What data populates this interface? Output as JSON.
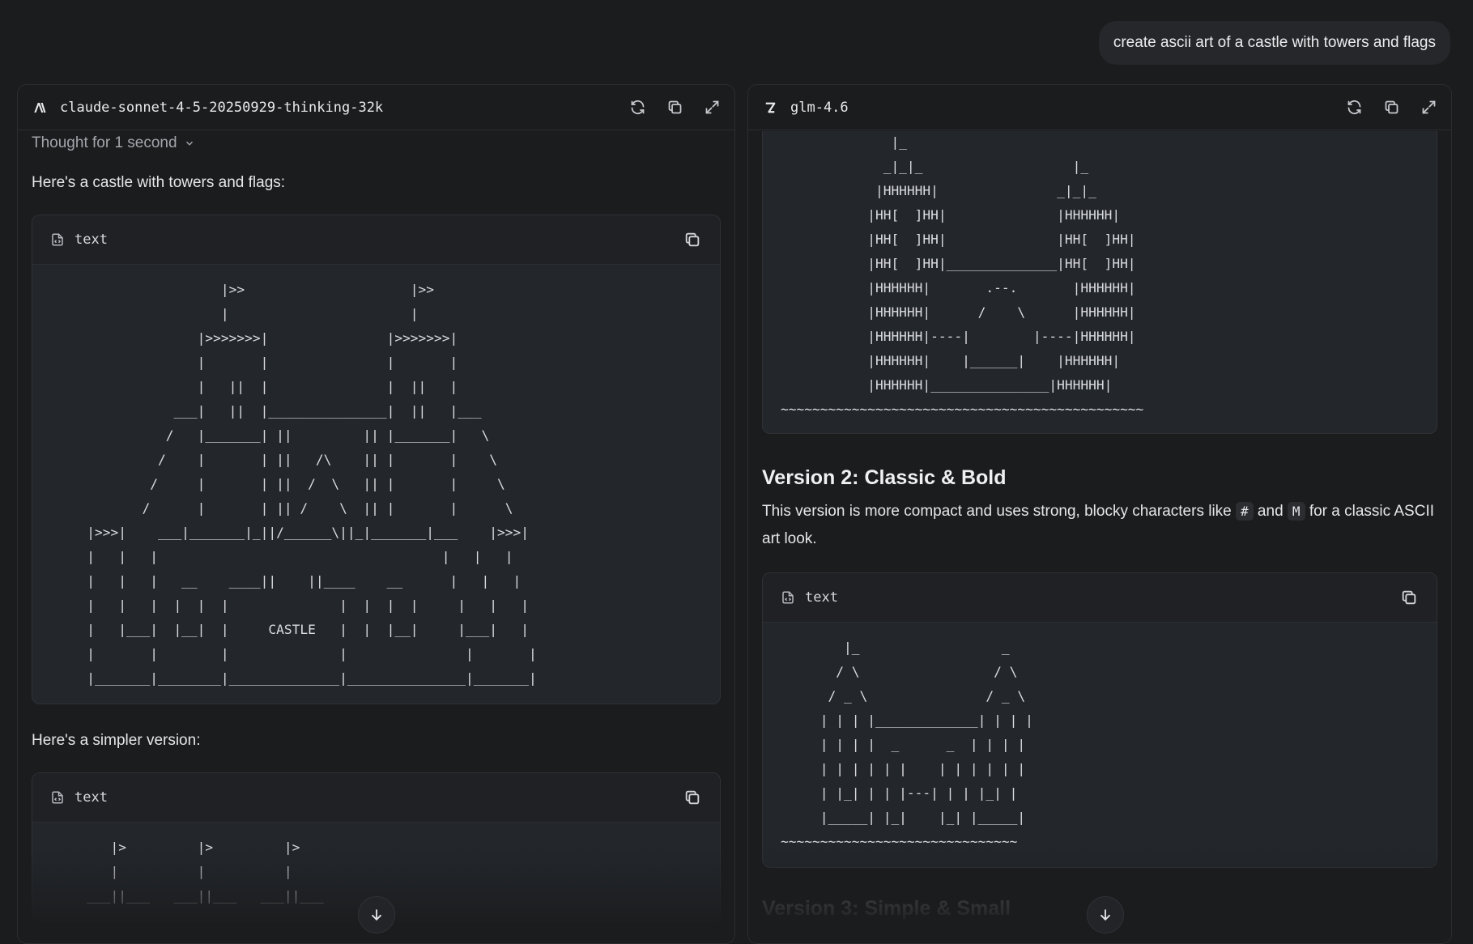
{
  "user_message": "create ascii art of a castle with towers and flags",
  "left": {
    "model_name": "claude-sonnet-4-5-20250929-thinking-32k",
    "thought_label": "Thought for 1 second",
    "intro": "Here's a castle with towers and flags:",
    "code1_lang": "text",
    "code1": "                    |>>                     |>>\n                    |                       |\n                 |>>>>>>>|               |>>>>>>>|\n                 |       |               |       |\n                 |   ||  |               |  ||   |\n              ___|   ||  |_______________|  ||   |___\n             /   |_______| ||         || |_______|   \\\n            /    |       | ||   /\\    || |       |    \\\n           /     |       | ||  /  \\   || |       |     \\\n          /      |       | || /    \\  || |       |      \\\n   |>>>|    ___|_______|_||/______\\||_|_______|___    |>>>|\n   |   |   |                                    |   |   |\n   |   |   |   __    ____||    ||____    __      |   |   |\n   |   |   |  |  |  |              |  |  |  |     |   |   |\n   |   |___|  |__|  |     CASTLE   |  |  |__|     |___|   |\n   |       |        |              |               |       |\n   |_______|________|______________|_______________|_______|",
    "simpler_label": "Here's a simpler version:",
    "code2_lang": "text",
    "code2": "      |>         |>         |>\n      |          |          |\n   ___||___   ___||___   ___||___"
  },
  "right": {
    "model_name": "glm-4.6",
    "code1": "              |_\n             _|_|_                   |_\n            |HHHHHH|               _|_|_\n           |HH[  ]HH|              |HHHHHH|\n           |HH[  ]HH|              |HH[  ]HH|\n           |HH[  ]HH|______________|HH[  ]HH|\n           |HHHHHH|       .--.       |HHHHHH|\n           |HHHHHH|      /    \\      |HHHHHH|\n           |HHHHHH|----|        |----|HHHHHH|\n           |HHHHHH|    |______|    |HHHHHH|\n           |HHHHHH|_______________|HHHHHH|\n~~~~~~~~~~~~~~~~~~~~~~~~~~~~~~~~~~~~~~~~~~~~~~",
    "version2_title": "Version 2: Classic & Bold",
    "version2_desc_a": "This version is more compact and uses strong, blocky characters like ",
    "code_hash": "#",
    "desc_and": " and ",
    "code_m": "M",
    "version2_desc_b": " for a classic ASCII art look.",
    "code2_lang": "text",
    "code2": "        |_                  _\n       / \\                 / \\\n      / _ \\               / _ \\\n     | | | |_____________| | | |\n     | | | |  _      _  | | | |\n     | | | | | |    | | | | | |\n     | |_| | | |---| | | |_| |\n     |_____| |_|    |_| |_____|\n~~~~~~~~~~~~~~~~~~~~~~~~~~~~~~",
    "version3_title": "Version 3: Simple & Small"
  }
}
